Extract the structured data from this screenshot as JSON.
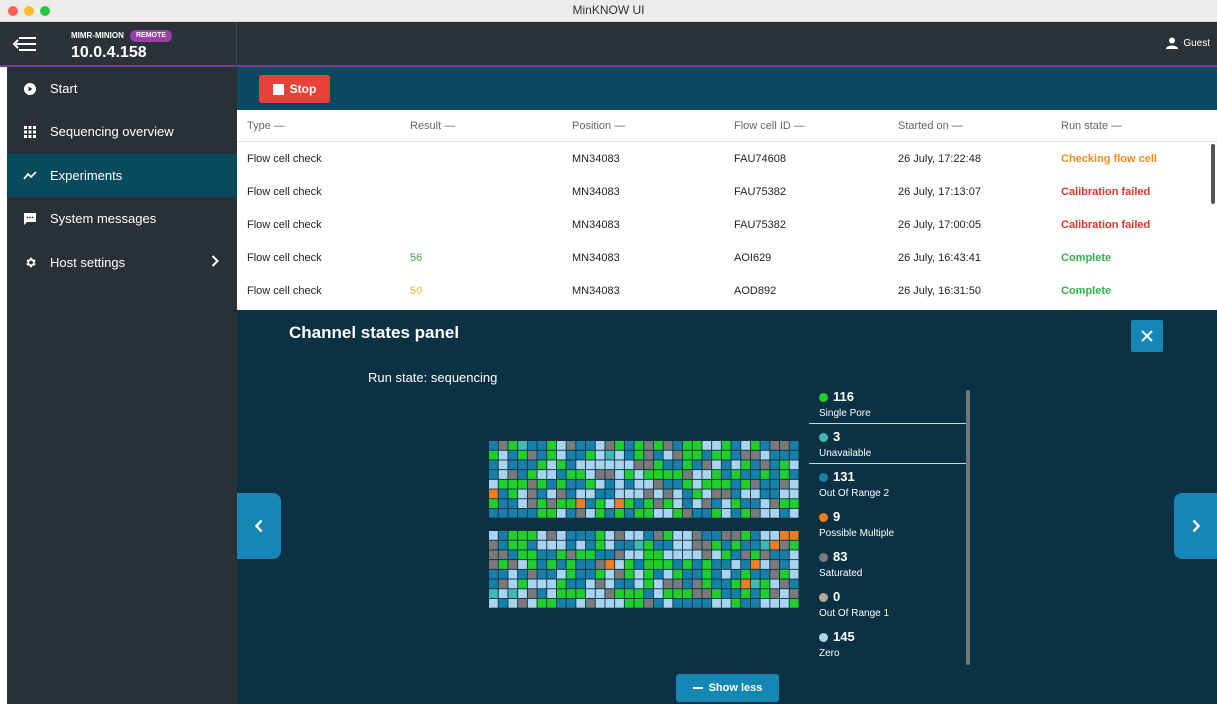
{
  "window": {
    "title": "MinKNOW UI",
    "traffic_lights": [
      "#fe5f57",
      "#febc2e",
      "#28c840"
    ]
  },
  "header": {
    "host_name": "MIMR-MINION",
    "badge": "REMOTE",
    "host_ip": "10.0.4.158",
    "user": "Guest",
    "menu_icon": "collapse-menu-icon",
    "user_icon": "user-icon"
  },
  "sidebar": {
    "items": [
      {
        "label": "Start",
        "icon": "play-circle-icon"
      },
      {
        "label": "Sequencing overview",
        "icon": "grid-icon"
      },
      {
        "label": "Experiments",
        "icon": "trend-icon",
        "active": true
      },
      {
        "label": "System messages",
        "icon": "message-icon"
      },
      {
        "label": "Host settings",
        "icon": "gear-icon",
        "has_submenu": true
      }
    ]
  },
  "toolbar": {
    "stop_label": "Stop"
  },
  "table": {
    "columns": [
      "Type —",
      "Result —",
      "Position —",
      "Flow cell ID —",
      "Started on —",
      "Run state —"
    ],
    "rows": [
      {
        "type": "Flow cell check",
        "result": "",
        "position": "MN34083",
        "flow_cell": "FAU74608",
        "started": "26 July, 17:22:48",
        "state": "Checking flow cell"
      },
      {
        "type": "Flow cell check",
        "result": "",
        "position": "MN34083",
        "flow_cell": "FAU75382",
        "started": "26 July, 17:13:07",
        "state": "Calibration failed"
      },
      {
        "type": "Flow cell check",
        "result": "",
        "position": "MN34083",
        "flow_cell": "FAU75382",
        "started": "26 July, 17:00:05",
        "state": "Calibration failed"
      },
      {
        "type": "Flow cell check",
        "result": "56",
        "position": "MN34083",
        "flow_cell": "AOI629",
        "started": "26 July, 16:43:41",
        "state": "Complete"
      },
      {
        "type": "Flow cell check",
        "result": "50",
        "position": "MN34083",
        "flow_cell": "AOD892",
        "started": "26 July, 16:31:50",
        "state": "Complete"
      }
    ],
    "result_colors": {
      "56": "#3fa83f",
      "50": "#f0b429"
    },
    "state_colors": {
      "Checking flow cell": "#f08a24",
      "Calibration failed": "#e0322c",
      "Complete": "#2fb24a"
    }
  },
  "panel": {
    "title": "Channel states panel",
    "run_state": "Run state: sequencing",
    "show_less": "Show less",
    "legend": [
      {
        "count": "116",
        "label": "Single Pore",
        "color": "#1fcf2b"
      },
      {
        "count": "3",
        "label": "Unavailable",
        "color": "#3fb9b1"
      },
      {
        "count": "131",
        "label": "Out Of Range 2",
        "color": "#1780a8"
      },
      {
        "count": "9",
        "label": "Possible Multiple",
        "color": "#f07d20"
      },
      {
        "count": "83",
        "label": "Saturated",
        "color": "#7a7a7a"
      },
      {
        "count": "0",
        "label": "Out Of Range 1",
        "color": "#b5a99a"
      },
      {
        "count": "145",
        "label": "Zero",
        "color": "#a8d4ef"
      }
    ]
  }
}
